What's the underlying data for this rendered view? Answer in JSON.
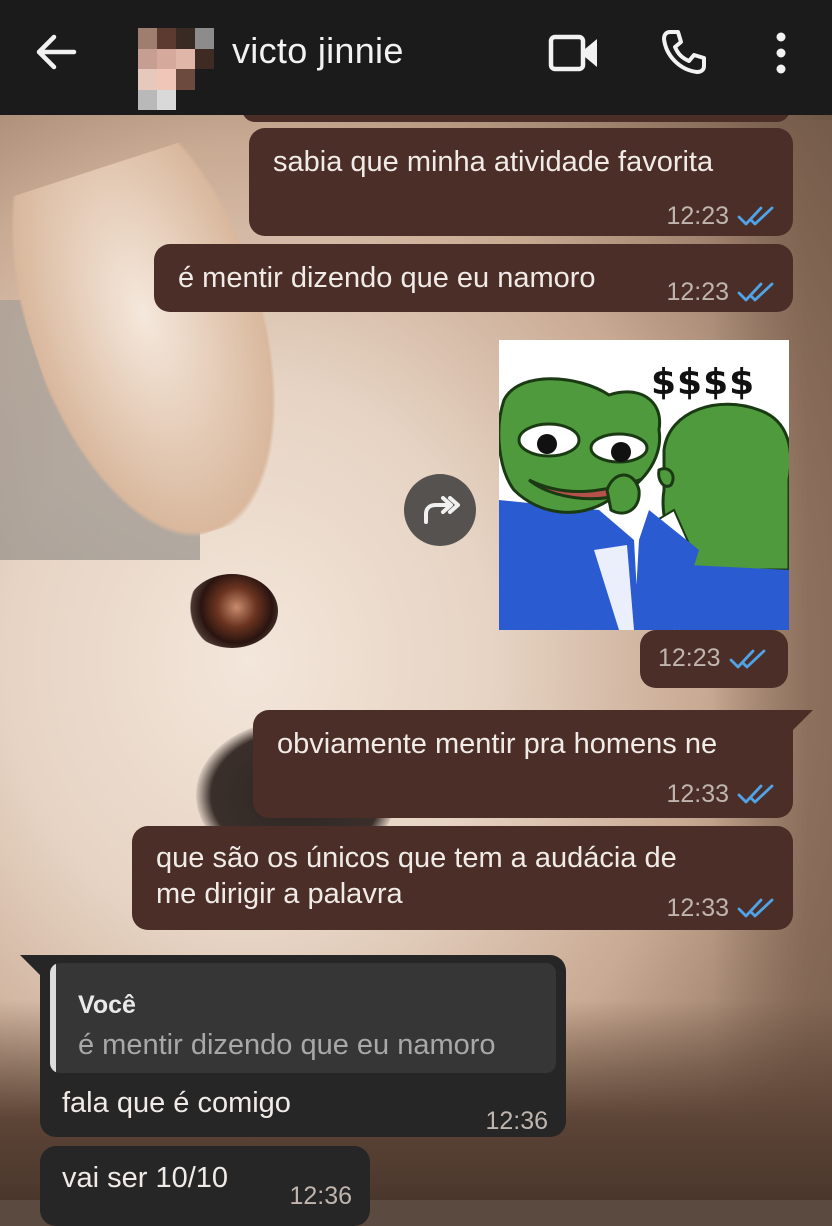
{
  "header": {
    "contact_name": "victo jinnie",
    "back_icon": "arrow-left-icon",
    "video_icon": "video-camera-icon",
    "call_icon": "phone-icon",
    "menu_icon": "more-vertical-icon"
  },
  "messages": [
    {
      "direction": "outgoing",
      "text": "sabia que minha atividade favorita",
      "time": "12:23",
      "status": "read"
    },
    {
      "direction": "outgoing",
      "text": "é mentir dizendo que eu namoro",
      "time": "12:23",
      "status": "read"
    },
    {
      "direction": "outgoing",
      "type": "sticker",
      "sticker_text": "$$$$",
      "time": "12:23",
      "status": "read"
    },
    {
      "direction": "outgoing",
      "text": "obviamente mentir pra homens ne",
      "time": "12:33",
      "status": "read"
    },
    {
      "direction": "outgoing",
      "text_line1": "que são os únicos que tem a audácia de",
      "text_line2": "me dirigir a palavra",
      "time": "12:33",
      "status": "read"
    },
    {
      "direction": "incoming",
      "reply_author": "Você",
      "reply_text": "é mentir dizendo que eu namoro",
      "text": "fala que é comigo",
      "time": "12:36"
    },
    {
      "direction": "incoming",
      "text": "vai ser 10/10",
      "time": "12:36"
    }
  ],
  "colors": {
    "topbar": "#1b1b1b",
    "outgoing_bubble": "#4b2e27",
    "incoming_bubble": "#262626",
    "read_ticks": "#4fa3e6"
  }
}
